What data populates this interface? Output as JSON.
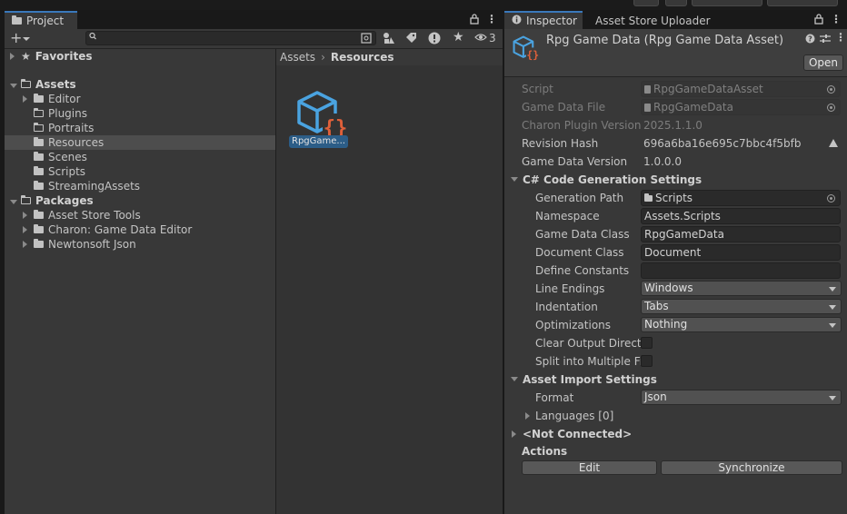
{
  "project_panel": {
    "tab_label": "Project",
    "hidden_count": "3",
    "tree": [
      {
        "label": "Favorites",
        "depth": 0,
        "expanded": false,
        "bold": true,
        "icon": "star-icon"
      },
      {
        "label": "Assets",
        "depth": 0,
        "expanded": true,
        "bold": true,
        "icon": "folder-open-icon"
      },
      {
        "label": "Editor",
        "depth": 1,
        "expanded": false,
        "icon": "folder-icon"
      },
      {
        "label": "Plugins",
        "depth": 1,
        "icon": "folder-open-icon"
      },
      {
        "label": "Portraits",
        "depth": 1,
        "icon": "folder-open-icon"
      },
      {
        "label": "Resources",
        "depth": 1,
        "icon": "folder-icon",
        "selected": true
      },
      {
        "label": "Scenes",
        "depth": 1,
        "icon": "folder-icon"
      },
      {
        "label": "Scripts",
        "depth": 1,
        "icon": "folder-icon"
      },
      {
        "label": "StreamingAssets",
        "depth": 1,
        "icon": "folder-icon"
      },
      {
        "label": "Packages",
        "depth": 0,
        "expanded": true,
        "bold": true,
        "icon": "folder-open-icon"
      },
      {
        "label": "Asset Store Tools",
        "depth": 1,
        "expanded": false,
        "icon": "folder-icon"
      },
      {
        "label": "Charon: Game Data Editor",
        "depth": 1,
        "expanded": false,
        "icon": "folder-icon"
      },
      {
        "label": "Newtonsoft Json",
        "depth": 1,
        "expanded": false,
        "icon": "folder-icon"
      }
    ],
    "breadcrumb": {
      "root": "Assets",
      "current": "Resources"
    },
    "asset": {
      "label": "RpgGame..."
    }
  },
  "inspector": {
    "tabs": [
      "Inspector",
      "Asset Store Uploader"
    ],
    "title": "Rpg Game Data (Rpg Game Data Asset)",
    "open_label": "Open",
    "rows": {
      "script": {
        "label": "Script",
        "value": "RpgGameDataAsset"
      },
      "game_data_file": {
        "label": "Game Data File",
        "value": "RpgGameData"
      },
      "plugin_version": {
        "label": "Charon Plugin Version",
        "value": "2025.1.1.0"
      },
      "revision_hash": {
        "label": "Revision Hash",
        "value": "696a6ba16e695c7bbc4f5bfb"
      },
      "game_data_version": {
        "label": "Game Data Version",
        "value": "1.0.0.0"
      }
    },
    "codegen": {
      "header": "C# Code Generation Settings",
      "generation_path": {
        "label": "Generation Path",
        "value": "Scripts"
      },
      "namespace": {
        "label": "Namespace",
        "value": "Assets.Scripts"
      },
      "game_data_class": {
        "label": "Game Data Class",
        "value": "RpgGameData"
      },
      "document_class": {
        "label": "Document Class",
        "value": "Document"
      },
      "define_constants": {
        "label": "Define Constants",
        "value": ""
      },
      "line_endings": {
        "label": "Line Endings",
        "value": "Windows"
      },
      "indentation": {
        "label": "Indentation",
        "value": "Tabs"
      },
      "optimizations": {
        "label": "Optimizations",
        "value": "Nothing"
      },
      "clear_output": {
        "label": "Clear Output Directo",
        "checked": false
      },
      "split_files": {
        "label": "Split into Multiple Fil",
        "checked": false
      }
    },
    "import": {
      "header": "Asset Import Settings",
      "format": {
        "label": "Format",
        "value": "Json"
      },
      "languages": {
        "label": "Languages [0]"
      }
    },
    "connection": "<Not Connected>",
    "actions": {
      "header": "Actions",
      "edit": "Edit",
      "synchronize": "Synchronize"
    }
  },
  "colors": {
    "accent": "#3a79bb",
    "selection": "#2c5d87",
    "asset_blue": "#4aa3e0",
    "asset_orange": "#e0603a"
  }
}
